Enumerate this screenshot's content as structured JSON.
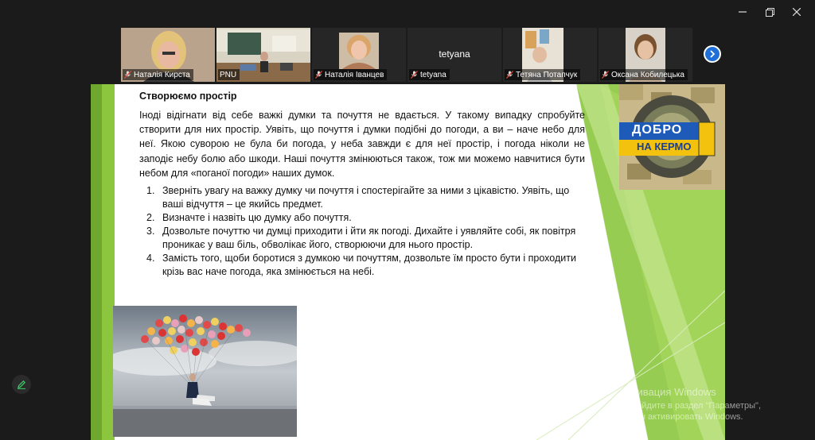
{
  "participants": [
    {
      "name": "Наталія Кирста",
      "muted": true,
      "active": false,
      "video": true
    },
    {
      "name": "PNU",
      "muted": false,
      "active": true,
      "video": true
    },
    {
      "name": "Наталія Іванцев",
      "muted": true,
      "active": false,
      "video": true
    },
    {
      "name": "tetyana",
      "display_name": "tetyana",
      "muted": true,
      "active": false,
      "video": false
    },
    {
      "name": "Тетяна Потапчук",
      "muted": true,
      "active": false,
      "video": true
    },
    {
      "name": "Оксана Кобилецька",
      "muted": true,
      "active": false,
      "video": true
    }
  ],
  "slide": {
    "heading": "Створюємо простір",
    "paragraph": "Іноді відігнати від себе важкі думки та почуття не вдається. У такому випадку спробуйте створити для них простір. Уявіть, що почуття і думки подібні до погоди, а ви – наче небо для неї. Якою суворою не була би погода, у неба завжди є для неї простір, і погода ніколи не заподіє небу болю або шкоди. Наші почуття змінюються також, тож ми можемо навчитися бути небом для «поганої погоди» наших думок.",
    "steps": [
      {
        "num": "1.",
        "text": "Зверніть увагу на важку думку чи почуття і спостерігайте за ними з цікавістю. Уявіть, що ваші відчуття – це якийсь предмет."
      },
      {
        "num": "2.",
        "text": "Визначте і назвіть цю думку або почуття."
      },
      {
        "num": "3.",
        "text": "Дозвольте почуттю чи думці приходити і йти як погоді. Дихайте і уявляйте собі, як повітря проникає у ваш біль, обволікає його, створюючи для нього простір."
      },
      {
        "num": "4.",
        "text": "Замість того, щоби боротися з думкою чи почуттям, дозвольте їм просто бути і проходити крізь вас наче погода, яка змінюється на небі."
      }
    ],
    "logo": {
      "line1": "ДОБРО",
      "line2": "НА КЕРМО"
    }
  },
  "watermark": {
    "title": "Активация Windows",
    "subtitle": "Перейдите в раздел \"Параметры\", чтобы активировать Windows."
  },
  "colors": {
    "accent_green": "#8cc63f",
    "active_tile": "#2ecc71",
    "next_button": "#1f6fd6"
  },
  "icons": [
    "minimize-icon",
    "restore-icon",
    "close-icon",
    "mic-muted-icon",
    "chevron-right-icon",
    "pencil-icon"
  ]
}
